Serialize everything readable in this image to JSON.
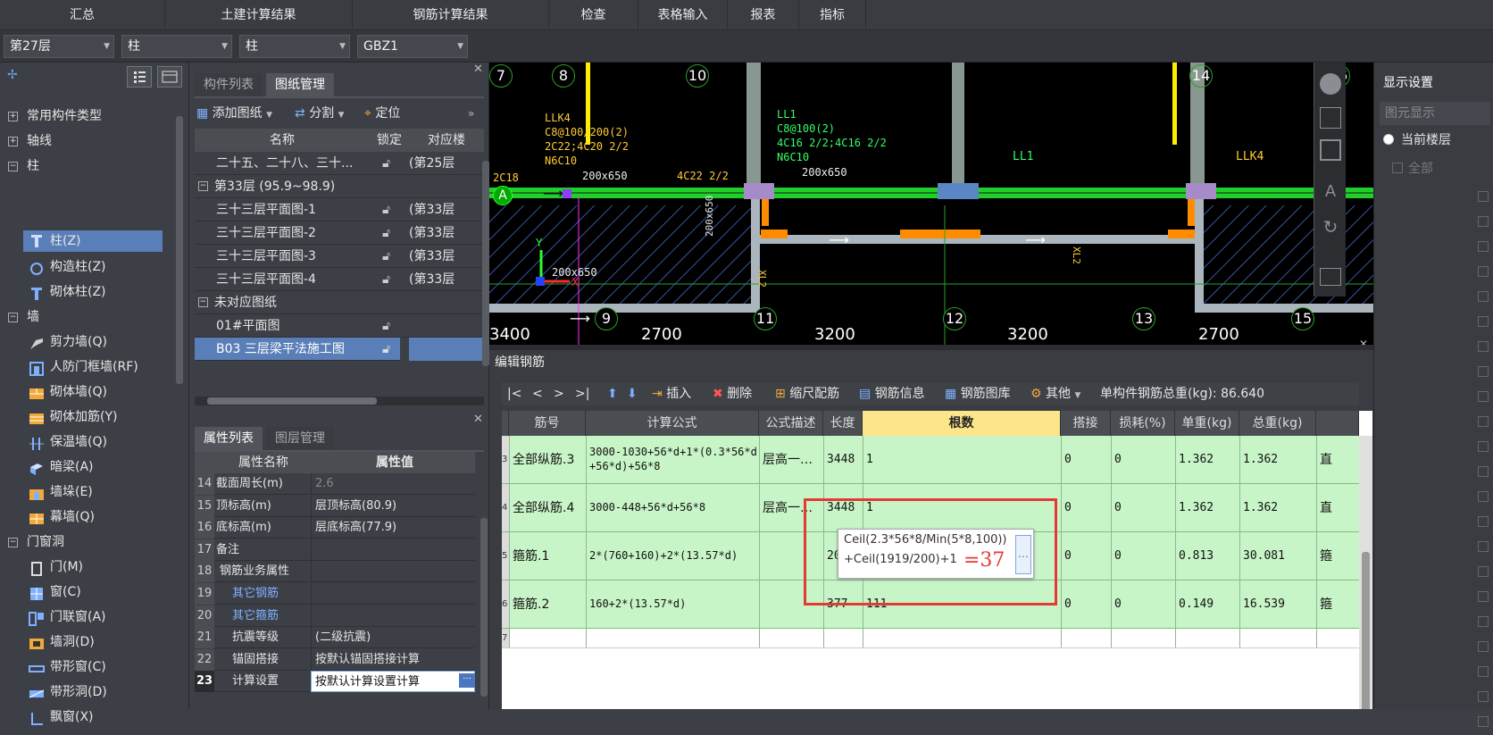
{
  "menu": [
    "汇总",
    "土建计算结果",
    "钢筋计算结果",
    "检查",
    "表格输入",
    "报表",
    "指标"
  ],
  "combos": {
    "floor": "第27层",
    "category": "柱",
    "type": "柱",
    "component": "GBZ1"
  },
  "tree": {
    "g1": "常用构件类型",
    "g2": "轴线",
    "g3": "柱",
    "col_z": "柱(Z)",
    "col_gz": "构造柱(Z)",
    "col_qt": "砌体柱(Z)",
    "g4": "墙",
    "w1": "剪力墙(Q)",
    "w2": "人防门框墙(RF)",
    "w3": "砌体墙(Q)",
    "w4": "砌体加筋(Y)",
    "w5": "保温墙(Q)",
    "w6": "暗梁(A)",
    "w7": "墙垛(E)",
    "w8": "幕墙(Q)",
    "g5": "门窗洞",
    "d1": "门(M)",
    "d2": "窗(C)",
    "d3": "门联窗(A)",
    "d4": "墙洞(D)",
    "d5": "带形窗(C)",
    "d6": "带形洞(D)",
    "d7": "飘窗(X)"
  },
  "drawpanel": {
    "tab1": "构件列表",
    "tab2": "图纸管理",
    "add": "添加图纸",
    "split": "分割",
    "locate": "定位",
    "headers": [
      "名称",
      "锁定",
      "对应楼"
    ],
    "rows": [
      {
        "name": "二十五、二十八、三十...",
        "floor": "(第25层"
      },
      {
        "name": "第33层 (95.9~98.9)",
        "floor": ""
      },
      {
        "name": "三十三层平面图-1",
        "floor": "(第33层"
      },
      {
        "name": "三十三层平面图-2",
        "floor": "(第33层"
      },
      {
        "name": "三十三层平面图-3",
        "floor": "(第33层"
      },
      {
        "name": "三十三层平面图-4",
        "floor": "(第33层"
      },
      {
        "name": "未对应图纸",
        "floor": ""
      },
      {
        "name": "01#平面图",
        "floor": ""
      },
      {
        "name": "B03 三层梁平法施工图",
        "floor": ""
      }
    ]
  },
  "props": {
    "tab1": "属性列表",
    "tab2": "图层管理",
    "h_name": "属性名称",
    "h_val": "属性值",
    "rows": [
      {
        "n": "14",
        "name": "截面周长(m)",
        "val": "2.6"
      },
      {
        "n": "15",
        "name": "顶标高(m)",
        "val": "层顶标高(80.9)"
      },
      {
        "n": "16",
        "name": "底标高(m)",
        "val": "层底标高(77.9)"
      },
      {
        "n": "17",
        "name": "备注",
        "val": ""
      },
      {
        "n": "18",
        "name": "钢筋业务属性",
        "val": ""
      },
      {
        "n": "19",
        "name": "其它钢筋",
        "val": ""
      },
      {
        "n": "20",
        "name": "其它箍筋",
        "val": ""
      },
      {
        "n": "21",
        "name": "抗震等级",
        "val": "(二级抗震)"
      },
      {
        "n": "22",
        "name": "锚固搭接",
        "val": "按默认锚固搭接计算"
      },
      {
        "n": "23",
        "name": "计算设置",
        "val": "按默认计算设置计算"
      }
    ]
  },
  "drawing": {
    "axes_top": [
      "7",
      "8",
      "10",
      "14",
      "16"
    ],
    "axes_bottom": [
      "9",
      "11",
      "12",
      "13",
      "15"
    ],
    "dims": [
      "3400",
      "2700",
      "3200",
      "3200",
      "2700"
    ],
    "row_label": "A",
    "labels": [
      "LLK4",
      "C8@100/200(2)",
      "2C22;4C20 2/2",
      "N6C10",
      "200x650",
      "4C22 2/2",
      "LL1",
      "C8@100(2)",
      "4C16 2/2;4C16 2/2",
      "N6C10",
      "200x650",
      "LL1",
      "LLK4",
      "2C18",
      "200x650",
      "200x650",
      "XL2",
      "XL2",
      "Y",
      "X"
    ]
  },
  "right": {
    "title": "显示设置",
    "tab": "图元显示",
    "opt": "当前楼层",
    "all": "全部"
  },
  "rebar": {
    "title": "编辑钢筋",
    "nav": [
      "|<",
      "<",
      ">",
      ">|"
    ],
    "insert": "插入",
    "delete": "删除",
    "scale": "缩尺配筋",
    "info": "钢筋信息",
    "lib": "钢筋图库",
    "other": "其他",
    "total_label": "单构件钢筋总重(kg): 86.640",
    "headers": [
      "筋号",
      "计算公式",
      "公式描述",
      "长度",
      "根数",
      "搭接",
      "损耗(%)",
      "单重(kg)",
      "总重(kg)"
    ],
    "rows": [
      {
        "n": "3",
        "name": "全部纵筋.3",
        "formula1": "3000-1030+56*d+1*(0.3*56*d",
        "formula2": "+56*d)+56*8",
        "desc": "层高一…",
        "len": "3448",
        "count": "1",
        "lap": "0",
        "loss": "0",
        "unit": "1.362",
        "total": "1.362",
        "extra": "直"
      },
      {
        "n": "4",
        "name": "全部纵筋.4",
        "formula1": "3000-448+56*d+56*8",
        "formula2": "",
        "desc": "层高一…",
        "len": "3448",
        "count": "1",
        "lap": "0",
        "loss": "0",
        "unit": "1.362",
        "total": "1.362",
        "extra": "直"
      },
      {
        "n": "5",
        "name": "箍筋.1",
        "formula1": "2*(760+160)+2*(13.57*d)",
        "formula2": "",
        "desc": "",
        "len": "2057",
        "count": "",
        "lap": "0",
        "loss": "0",
        "unit": "0.813",
        "total": "30.081",
        "extra": "箍"
      },
      {
        "n": "6",
        "name": "箍筋.2",
        "formula1": "160+2*(13.57*d)",
        "formula2": "",
        "desc": "",
        "len": "377",
        "count": "111",
        "lap": "0",
        "loss": "0",
        "unit": "0.149",
        "total": "16.539",
        "extra": "箍"
      },
      {
        "n": "7",
        "name": "",
        "formula1": "",
        "formula2": "",
        "desc": "",
        "len": "",
        "count": "",
        "lap": "",
        "loss": "",
        "unit": "",
        "total": "",
        "extra": ""
      }
    ],
    "popup_line1": "Ceil(2.3*56*8/Min(5*8,100))",
    "popup_line2": "+Ceil(1919/200)+1",
    "popup_btn": "…",
    "annotation": "=37"
  }
}
